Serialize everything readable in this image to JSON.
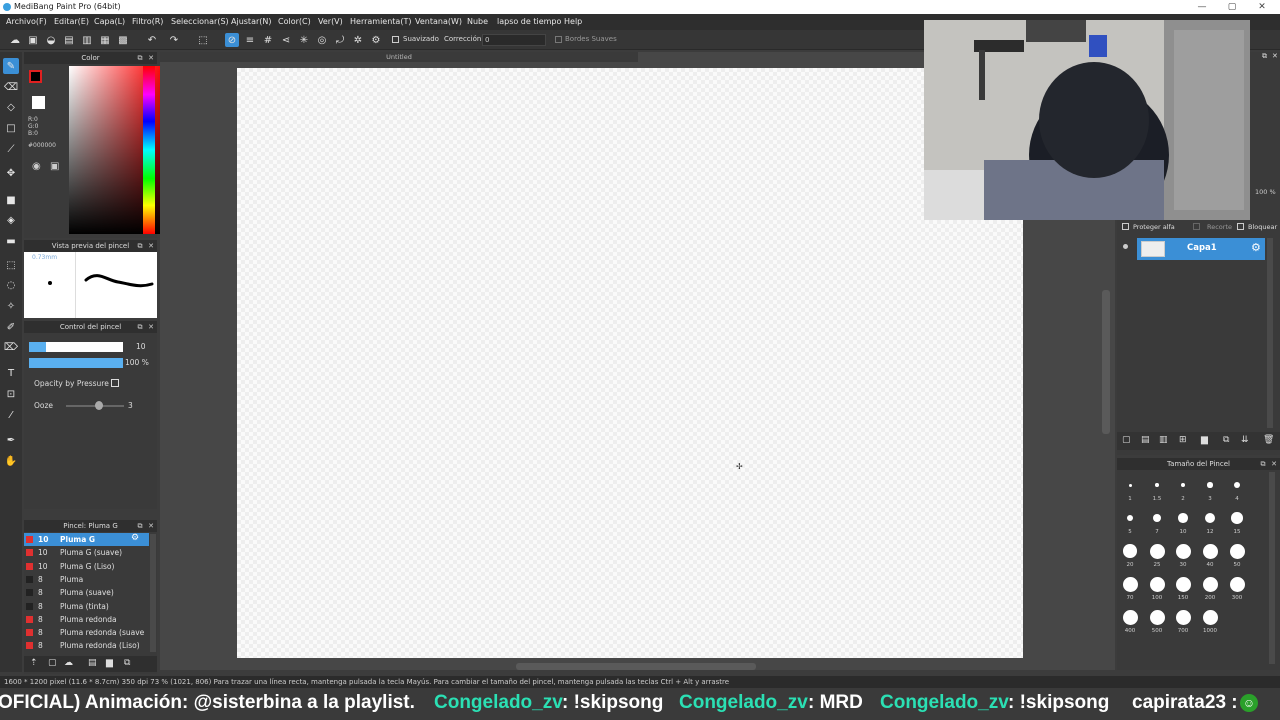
{
  "window": {
    "title": "MediBang Paint Pro (64bit)",
    "minimize": "—",
    "maximize": "▢",
    "close": "✕"
  },
  "colors": {
    "accent": "#3b8fd6",
    "panel_bg": "#3a3a3a",
    "menubar_bg": "#2e2e2e",
    "canvas_bg": "#474747",
    "fg_swatch": "#000000",
    "fg_border": "#e02020"
  },
  "menu": [
    "Archivo(F)",
    "Editar(E)",
    "Capa(L)",
    "Filtro(R)",
    "Seleccionar(S)",
    "Ajustar(N)",
    "Color(C)",
    "Ver(V)",
    "Herramienta(T)",
    "Ventana(W)",
    "Nube",
    "lapso de tiempo",
    "Help"
  ],
  "toolbar": {
    "suavizado": "Suavizado",
    "correccion": "Corrección",
    "correccion_value": "0",
    "bordes": "Bordes Suaves"
  },
  "color_panel": {
    "title": "Color",
    "r": "R:0",
    "g": "G:0",
    "b": "B:0",
    "hex": "#000000"
  },
  "preview_panel": {
    "title": "Vista previa del pincel",
    "size": "0.73mm"
  },
  "control_panel": {
    "title": "Control del pincel",
    "size_value": "10",
    "opacity_value": "100 %",
    "opacity_pressure": "Opacity by Pressure",
    "ooze_label": "Ooze",
    "ooze_value": "3"
  },
  "brush_panel": {
    "title": "Pincel: Pluma G",
    "items": [
      {
        "size": "10",
        "name": "Pluma G",
        "color": "#e03030"
      },
      {
        "size": "10",
        "name": "Pluma G (suave)",
        "color": "#e03030"
      },
      {
        "size": "10",
        "name": "Pluma G (Liso)",
        "color": "#e03030"
      },
      {
        "size": "8",
        "name": "Pluma",
        "color": "#222222"
      },
      {
        "size": "8",
        "name": "Pluma (suave)",
        "color": "#222222"
      },
      {
        "size": "8",
        "name": "Pluma (tinta)",
        "color": "#222222"
      },
      {
        "size": "8",
        "name": "Pluma redonda",
        "color": "#e03030"
      },
      {
        "size": "8",
        "name": "Pluma redonda (suave",
        "color": "#e03030"
      },
      {
        "size": "8",
        "name": "Pluma redonda (Liso)",
        "color": "#e03030"
      }
    ]
  },
  "document": {
    "tab": "Untitled"
  },
  "layer_panel": {
    "proteger": "Proteger alfa",
    "recorte": "Recorte",
    "bloquear": "Bloquear",
    "layer_name": "Capa1",
    "zoom": "100 %"
  },
  "size_panel": {
    "title": "Tamaño del Pincel",
    "sizes": [
      "1",
      "1.5",
      "2",
      "3",
      "4",
      "5",
      "7",
      "10",
      "12",
      "15",
      "20",
      "25",
      "30",
      "40",
      "50",
      "70",
      "100",
      "150",
      "200",
      "300",
      "400",
      "500",
      "700",
      "1000"
    ]
  },
  "status": {
    "text": "1600 * 1200 pixel   (11.6 * 8.7cm)   350 dpi   73 %   (1021, 806)   Para trazar una línea recta, mantenga pulsada la tecla Mayús. Para cambiar el tamaño del pincel, mantenga pulsada las teclas Ctrl + Alt y arrastre"
  },
  "ticker": {
    "part1": "OFICIAL) Animación: @sisterbina a la playlist.",
    "part2": "Congelado_zv",
    "part3": ": !skipsong",
    "part4": "Congelado_zv",
    "part5": ": MRD",
    "part6": "Congelado_zv",
    "part7": ": !skipsong",
    "part8": "capirata23 :"
  }
}
